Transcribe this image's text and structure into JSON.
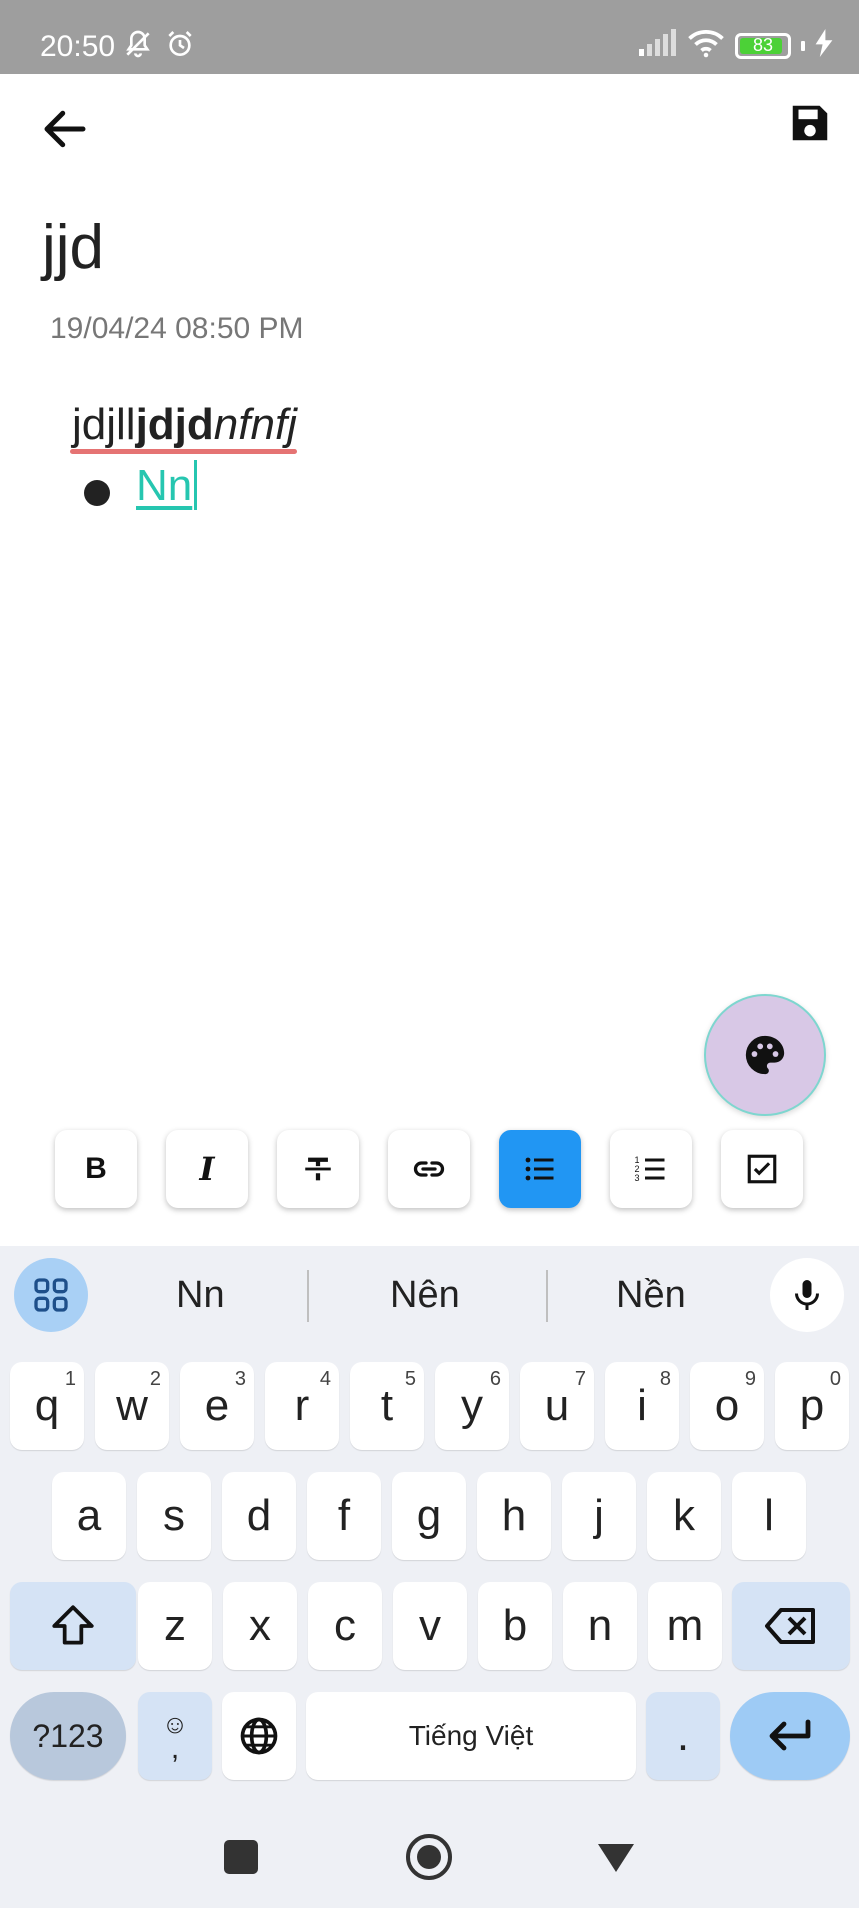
{
  "status_bar": {
    "time": "20:50",
    "battery_level": "83",
    "icons": [
      "mute-bell-icon",
      "alarm-icon",
      "signal-icon",
      "wifi-icon",
      "battery-icon",
      "charging-bolt-icon"
    ]
  },
  "app_bar": {
    "back_icon": "arrow-back-icon",
    "save_icon": "floppy-save-icon"
  },
  "note": {
    "title": "jjd",
    "date": "19/04/24 08:50 PM",
    "content": {
      "line1_plain": "jdjll",
      "line1_bold": "jdjd",
      "line1_italic": "nfnfj",
      "bullet_item": "Nn"
    }
  },
  "fab": {
    "icon": "palette-icon"
  },
  "format_toolbar": {
    "buttons": [
      {
        "name": "bold",
        "label": "B",
        "active": false
      },
      {
        "name": "italic",
        "label": "I",
        "active": false
      },
      {
        "name": "strikethrough",
        "label": "strikethrough",
        "active": false
      },
      {
        "name": "link",
        "label": "link",
        "active": false
      },
      {
        "name": "bulleted-list",
        "label": "bulleted list",
        "active": true
      },
      {
        "name": "numbered-list",
        "label": "numbered list",
        "active": false
      },
      {
        "name": "checklist",
        "label": "checklist",
        "active": false
      }
    ],
    "active_color": "#2196f3"
  },
  "keyboard": {
    "suggestions": [
      "Nn",
      "Nên",
      "Nền"
    ],
    "row1": [
      {
        "k": "q",
        "h": "1"
      },
      {
        "k": "w",
        "h": "2"
      },
      {
        "k": "e",
        "h": "3"
      },
      {
        "k": "r",
        "h": "4"
      },
      {
        "k": "t",
        "h": "5"
      },
      {
        "k": "y",
        "h": "6"
      },
      {
        "k": "u",
        "h": "7"
      },
      {
        "k": "i",
        "h": "8"
      },
      {
        "k": "o",
        "h": "9"
      },
      {
        "k": "p",
        "h": "0"
      }
    ],
    "row2": [
      "a",
      "s",
      "d",
      "f",
      "g",
      "h",
      "j",
      "k",
      "l"
    ],
    "row3": [
      "z",
      "x",
      "c",
      "v",
      "b",
      "n",
      "m"
    ],
    "symbols_label": "?123",
    "emoji_comma": ",",
    "space_label": "Tiếng Việt",
    "period_label": "."
  }
}
